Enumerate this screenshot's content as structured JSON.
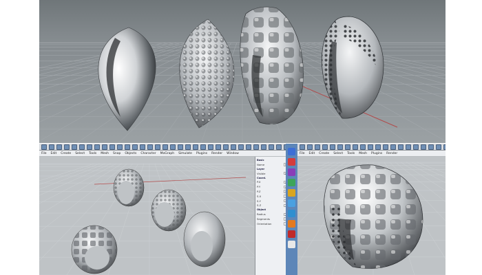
{
  "menus": {
    "left": [
      "File",
      "Edit",
      "Create",
      "Select",
      "Tools",
      "Mesh",
      "Snap",
      "Objects",
      "Character",
      "MoGraph",
      "Simulate",
      "Plugins",
      "Render",
      "Window"
    ],
    "right": [
      "File",
      "Edit",
      "Create",
      "Select",
      "Tools",
      "Mesh",
      "Plugins",
      "Render"
    ]
  },
  "attributes": {
    "rows": [
      {
        "label": "Basic",
        "value": ""
      },
      {
        "label": "Name",
        "value": "Ring"
      },
      {
        "label": "Layer",
        "value": ""
      },
      {
        "label": "Visible",
        "value": "Default"
      },
      {
        "label": "Coord.",
        "value": ""
      },
      {
        "label": "P.X",
        "value": "0 cm"
      },
      {
        "label": "P.Y",
        "value": "0 cm"
      },
      {
        "label": "P.Z",
        "value": "0 cm"
      },
      {
        "label": "S.X",
        "value": "1"
      },
      {
        "label": "S.Y",
        "value": "1"
      },
      {
        "label": "S.Z",
        "value": "1"
      },
      {
        "label": "Object",
        "value": ""
      },
      {
        "label": "Radius",
        "value": "2 cm"
      },
      {
        "label": "Segments",
        "value": "36"
      },
      {
        "label": "Orientation",
        "value": "+Y"
      }
    ]
  },
  "colors": {
    "viewport_bg": "#7d8387",
    "panel_bg": "#eef0f3",
    "icon_bar": "#5d86b8",
    "grid_line": "#9aa0a4",
    "axis_red": "#b24a4a"
  },
  "icons": [
    "app-icon-blue",
    "app-icon-red",
    "app-icon-purple",
    "app-icon-green",
    "app-icon-gold",
    "app-icon-chrome",
    "app-icon-globe",
    "app-icon-orange",
    "app-icon-red-circle",
    "app-icon-edit"
  ]
}
